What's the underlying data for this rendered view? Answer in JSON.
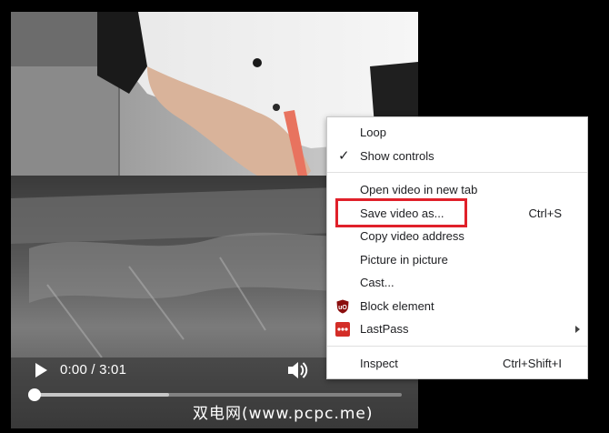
{
  "video": {
    "current_time": "0:00",
    "duration": "3:01",
    "time_separator": "/",
    "progress": 0,
    "buffered": 0.37,
    "controls": {
      "play_icon": "play-icon",
      "volume_icon": "volume-icon"
    }
  },
  "context_menu": {
    "items": [
      {
        "label": "Loop",
        "checked": false
      },
      {
        "label": "Show controls",
        "checked": true,
        "check_glyph": "✓"
      },
      {
        "label": "Open video in new tab"
      },
      {
        "label": "Save video as...",
        "shortcut": "Ctrl+S",
        "highlighted": true
      },
      {
        "label": "Copy video address"
      },
      {
        "label": "Picture in picture"
      },
      {
        "label": "Cast..."
      },
      {
        "label": "Block element",
        "icon": "ublock-icon"
      },
      {
        "label": "LastPass",
        "icon": "lastpass-icon",
        "has_submenu": true
      },
      {
        "label": "Inspect",
        "shortcut": "Ctrl+Shift+I"
      }
    ]
  },
  "watermark": {
    "text": "双电网(www.pcpc.me)"
  },
  "colors": {
    "highlight_border": "#e0202a",
    "ublock_red": "#8b0f0f",
    "lastpass_red": "#d32d27"
  }
}
